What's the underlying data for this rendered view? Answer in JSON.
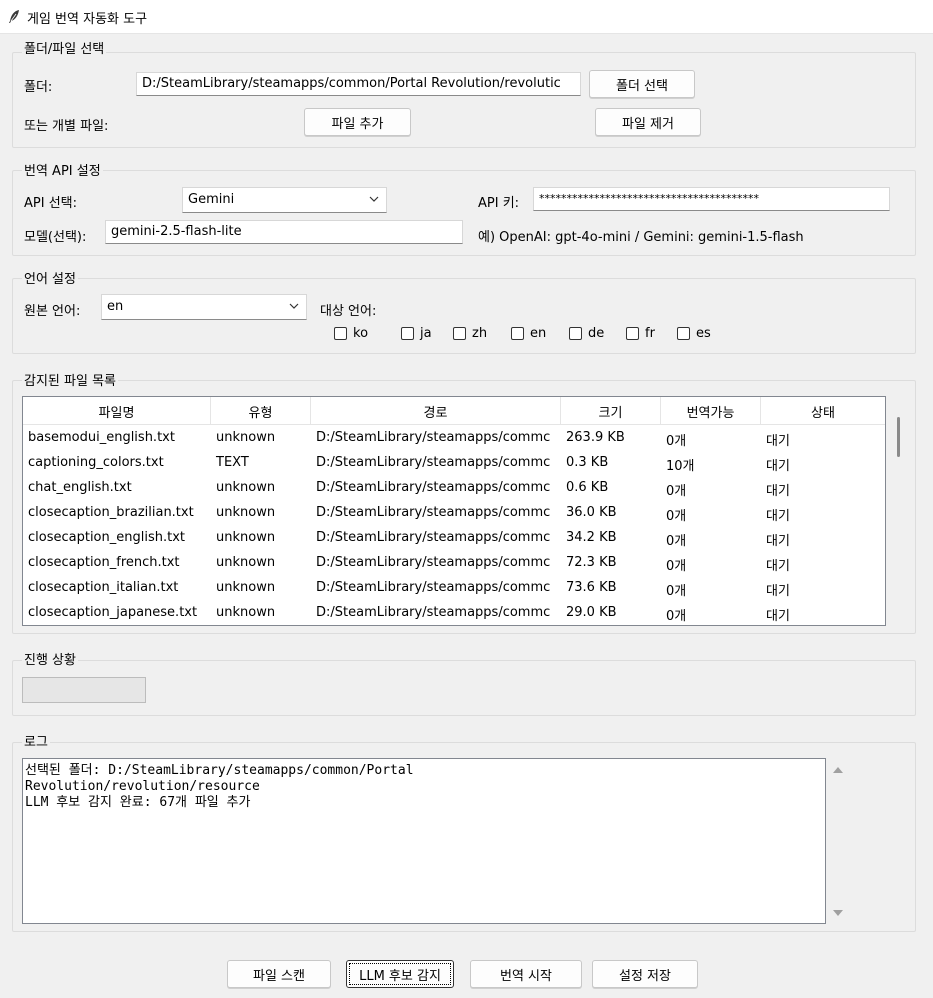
{
  "window": {
    "title": "게임 번역 자동화 도구",
    "icon": "feather-icon"
  },
  "folder_section": {
    "group_label": "폴더/파일 선택",
    "folder_label": "폴더:",
    "folder_value": "D:/SteamLibrary/steamapps/common/Portal Revolution/revolutic",
    "select_folder_button": "폴더 선택",
    "individual_label": "또는 개별 파일:",
    "add_file_button": "파일 추가",
    "remove_file_button": "파일 제거"
  },
  "api_section": {
    "group_label": "번역 API 설정",
    "api_select_label": "API 선택:",
    "api_select_value": "Gemini",
    "api_key_label": "API 키:",
    "api_key_value": "****************************************",
    "model_label": "모델(선택):",
    "model_value": "gemini-2.5-flash-lite",
    "model_hint": "예) OpenAI: gpt-4o-mini / Gemini: gemini-1.5-flash"
  },
  "language_section": {
    "group_label": "언어 설정",
    "source_label": "원본 언어:",
    "source_value": "en",
    "target_label": "대상 언어:",
    "targets": [
      {
        "label": "ko",
        "checked": false
      },
      {
        "label": "ja",
        "checked": false
      },
      {
        "label": "zh",
        "checked": false
      },
      {
        "label": "en",
        "checked": false
      },
      {
        "label": "de",
        "checked": false
      },
      {
        "label": "fr",
        "checked": false
      },
      {
        "label": "es",
        "checked": false
      }
    ]
  },
  "files_section": {
    "group_label": "감지된 파일 목록",
    "columns": [
      "파일명",
      "유형",
      "경로",
      "크기",
      "번역가능",
      "상태"
    ],
    "rows": [
      [
        "basemodui_english.txt",
        "unknown",
        "D:/SteamLibrary/steamapps/commc",
        "263.9 KB",
        "0개",
        "대기"
      ],
      [
        "captioning_colors.txt",
        "TEXT",
        "D:/SteamLibrary/steamapps/commc",
        "0.3 KB",
        "10개",
        "대기"
      ],
      [
        "chat_english.txt",
        "unknown",
        "D:/SteamLibrary/steamapps/commc",
        "0.6 KB",
        "0개",
        "대기"
      ],
      [
        "closecaption_brazilian.txt",
        "unknown",
        "D:/SteamLibrary/steamapps/commc",
        "36.0 KB",
        "0개",
        "대기"
      ],
      [
        "closecaption_english.txt",
        "unknown",
        "D:/SteamLibrary/steamapps/commc",
        "34.2 KB",
        "0개",
        "대기"
      ],
      [
        "closecaption_french.txt",
        "unknown",
        "D:/SteamLibrary/steamapps/commc",
        "72.3 KB",
        "0개",
        "대기"
      ],
      [
        "closecaption_italian.txt",
        "unknown",
        "D:/SteamLibrary/steamapps/commc",
        "73.6 KB",
        "0개",
        "대기"
      ],
      [
        "closecaption_japanese.txt",
        "unknown",
        "D:/SteamLibrary/steamapps/commc",
        "29.0 KB",
        "0개",
        "대기"
      ]
    ]
  },
  "progress_section": {
    "group_label": "진행 상황",
    "progress": 0
  },
  "log_section": {
    "group_label": "로그",
    "text": "선택된 폴더: D:/SteamLibrary/steamapps/common/Portal\nRevolution/revolution/resource\nLLM 후보 감지 완료: 67개 파일 추가"
  },
  "bottom_buttons": {
    "scan": "파일 스캔",
    "llm_detect": "LLM 후보 감지",
    "start": "번역 시작",
    "save": "설정 저장"
  },
  "colors": {
    "window_bg": "#f0f0f0",
    "field_bg": "#ffffff",
    "border": "#dcdcdc"
  }
}
